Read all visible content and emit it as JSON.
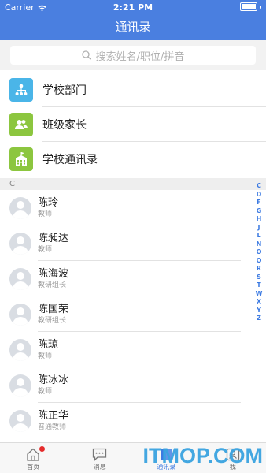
{
  "status_bar": {
    "carrier": "Carrier",
    "time": "2:21 PM"
  },
  "nav": {
    "title": "通讯录"
  },
  "search": {
    "placeholder": "搜索姓名/职位/拼音"
  },
  "entries": [
    {
      "label": "学校部门",
      "icon": "org-chart-icon",
      "color": "#4ab5e8"
    },
    {
      "label": "班级家长",
      "icon": "contacts-icon",
      "color": "#8cc63f"
    },
    {
      "label": "学校通讯录",
      "icon": "school-icon",
      "color": "#8cc63f"
    }
  ],
  "section": {
    "letter": "C"
  },
  "contacts": [
    {
      "name": "陈玲",
      "role": "教师"
    },
    {
      "name": "陈昶达",
      "role": "教师"
    },
    {
      "name": "陈海波",
      "role": "教研组长"
    },
    {
      "name": "陈国荣",
      "role": "教研组长"
    },
    {
      "name": "陈琼",
      "role": "教师"
    },
    {
      "name": "陈冰冰",
      "role": "教师"
    },
    {
      "name": "陈正华",
      "role": "普通教师"
    }
  ],
  "index_letters": [
    "C",
    "D",
    "F",
    "G",
    "H",
    "J",
    "L",
    "N",
    "O",
    "Q",
    "R",
    "S",
    "T",
    "W",
    "X",
    "Y",
    "Z"
  ],
  "tabs": [
    {
      "label": "首页",
      "icon": "home-icon",
      "active": false,
      "badge": true
    },
    {
      "label": "消息",
      "icon": "message-icon",
      "active": false,
      "badge": false
    },
    {
      "label": "通讯录",
      "icon": "contacts-book-icon",
      "active": true,
      "badge": false
    },
    {
      "label": "我",
      "icon": "profile-icon",
      "active": false,
      "badge": false
    }
  ],
  "watermark": "ITMOP.COM",
  "colors": {
    "primary": "#4a7fe0",
    "index": "#3d7be2",
    "badge": "#e52b2b"
  }
}
